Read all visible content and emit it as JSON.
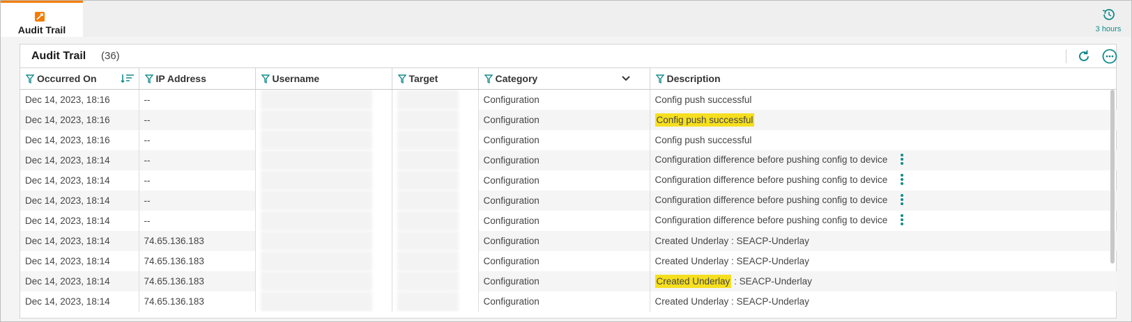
{
  "tab": {
    "label": "Audit Trail",
    "icon": "audit-trail-icon"
  },
  "time_range": {
    "label": "3 hours",
    "icon": "history-icon"
  },
  "panel": {
    "title": "Audit Trail",
    "count": "(36)"
  },
  "colors": {
    "accent": "#f57c00",
    "teal": "#138b8b",
    "highlight": "#f6df1f"
  },
  "columns": [
    {
      "label": "Occurred On"
    },
    {
      "label": "IP Address"
    },
    {
      "label": "Username"
    },
    {
      "label": "Target"
    },
    {
      "label": "Category"
    },
    {
      "label": "Description"
    }
  ],
  "rows": [
    {
      "occurred": "Dec 14, 2023, 18:16",
      "ip": "--",
      "username": "",
      "target": "",
      "category": "Configuration",
      "desc_hl": "",
      "desc": "Config push successful",
      "has_menu": false
    },
    {
      "occurred": "Dec 14, 2023, 18:16",
      "ip": "--",
      "username": "",
      "target": "",
      "category": "Configuration",
      "desc_hl": "Config push successful",
      "desc": "",
      "has_menu": false
    },
    {
      "occurred": "Dec 14, 2023, 18:16",
      "ip": "--",
      "username": "",
      "target": "",
      "category": "Configuration",
      "desc_hl": "",
      "desc": "Config push successful",
      "has_menu": false
    },
    {
      "occurred": "Dec 14, 2023, 18:14",
      "ip": "--",
      "username": "",
      "target": "",
      "category": "Configuration",
      "desc_hl": "",
      "desc": "Configuration difference before pushing config to device",
      "has_menu": true
    },
    {
      "occurred": "Dec 14, 2023, 18:14",
      "ip": "--",
      "username": "",
      "target": "",
      "category": "Configuration",
      "desc_hl": "",
      "desc": "Configuration difference before pushing config to device",
      "has_menu": true
    },
    {
      "occurred": "Dec 14, 2023, 18:14",
      "ip": "--",
      "username": "",
      "target": "",
      "category": "Configuration",
      "desc_hl": "",
      "desc": "Configuration difference before pushing config to device",
      "has_menu": true
    },
    {
      "occurred": "Dec 14, 2023, 18:14",
      "ip": "--",
      "username": "",
      "target": "",
      "category": "Configuration",
      "desc_hl": "",
      "desc": "Configuration difference before pushing config to device",
      "has_menu": true
    },
    {
      "occurred": "Dec 14, 2023, 18:14",
      "ip": "74.65.136.183",
      "username": "",
      "target": "",
      "category": "Configuration",
      "desc_hl": "",
      "desc": "Created Underlay : SEACP-Underlay",
      "has_menu": false
    },
    {
      "occurred": "Dec 14, 2023, 18:14",
      "ip": "74.65.136.183",
      "username": "",
      "target": "",
      "category": "Configuration",
      "desc_hl": "",
      "desc": "Created Underlay : SEACP-Underlay",
      "has_menu": false
    },
    {
      "occurred": "Dec 14, 2023, 18:14",
      "ip": "74.65.136.183",
      "username": "",
      "target": "",
      "category": "Configuration",
      "desc_hl": "Created Underlay",
      "desc": " : SEACP-Underlay",
      "has_menu": false
    },
    {
      "occurred": "Dec 14, 2023, 18:14",
      "ip": "74.65.136.183",
      "username": "",
      "target": "",
      "category": "Configuration",
      "desc_hl": "",
      "desc": "Created Underlay : SEACP-Underlay",
      "has_menu": false
    }
  ]
}
